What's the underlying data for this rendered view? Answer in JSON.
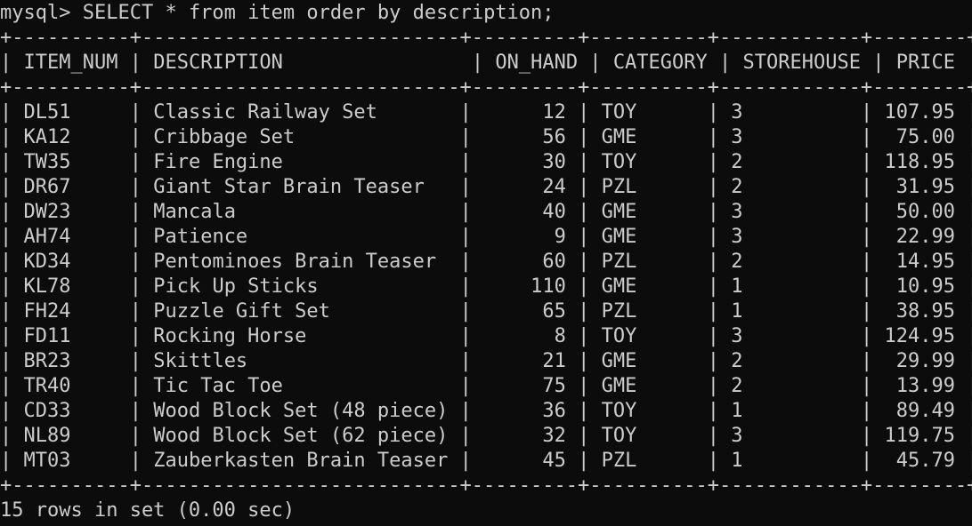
{
  "terminal": {
    "prompt": "mysql>",
    "command": "SELECT * from item order by description;",
    "border_line": "+----------+---------------------------+---------+----------+------------+--------+",
    "header": {
      "item_num": "ITEM_NUM",
      "description": "DESCRIPTION",
      "on_hand": "ON_HAND",
      "category": "CATEGORY",
      "storehouse": "STOREHOUSE",
      "price": "PRICE"
    },
    "rows": [
      {
        "item_num": "DL51",
        "description": "Classic Railway Set",
        "on_hand": "12",
        "category": "TOY",
        "storehouse": "3",
        "price": "107.95"
      },
      {
        "item_num": "KA12",
        "description": "Cribbage Set",
        "on_hand": "56",
        "category": "GME",
        "storehouse": "3",
        "price": "75.00"
      },
      {
        "item_num": "TW35",
        "description": "Fire Engine",
        "on_hand": "30",
        "category": "TOY",
        "storehouse": "2",
        "price": "118.95"
      },
      {
        "item_num": "DR67",
        "description": "Giant Star Brain Teaser",
        "on_hand": "24",
        "category": "PZL",
        "storehouse": "2",
        "price": "31.95"
      },
      {
        "item_num": "DW23",
        "description": "Mancala",
        "on_hand": "40",
        "category": "GME",
        "storehouse": "3",
        "price": "50.00"
      },
      {
        "item_num": "AH74",
        "description": "Patience",
        "on_hand": "9",
        "category": "GME",
        "storehouse": "3",
        "price": "22.99"
      },
      {
        "item_num": "KD34",
        "description": "Pentominoes Brain Teaser",
        "on_hand": "60",
        "category": "PZL",
        "storehouse": "2",
        "price": "14.95"
      },
      {
        "item_num": "KL78",
        "description": "Pick Up Sticks",
        "on_hand": "110",
        "category": "GME",
        "storehouse": "1",
        "price": "10.95"
      },
      {
        "item_num": "FH24",
        "description": "Puzzle Gift Set",
        "on_hand": "65",
        "category": "PZL",
        "storehouse": "1",
        "price": "38.95"
      },
      {
        "item_num": "FD11",
        "description": "Rocking Horse",
        "on_hand": "8",
        "category": "TOY",
        "storehouse": "3",
        "price": "124.95"
      },
      {
        "item_num": "BR23",
        "description": "Skittles",
        "on_hand": "21",
        "category": "GME",
        "storehouse": "2",
        "price": "29.99"
      },
      {
        "item_num": "TR40",
        "description": "Tic Tac Toe",
        "on_hand": "75",
        "category": "GME",
        "storehouse": "2",
        "price": "13.99"
      },
      {
        "item_num": "CD33",
        "description": "Wood Block Set (48 piece)",
        "on_hand": "36",
        "category": "TOY",
        "storehouse": "1",
        "price": "89.49"
      },
      {
        "item_num": "NL89",
        "description": "Wood Block Set (62 piece)",
        "on_hand": "32",
        "category": "TOY",
        "storehouse": "3",
        "price": "119.75"
      },
      {
        "item_num": "MT03",
        "description": "Zauberkasten Brain Teaser",
        "on_hand": "45",
        "category": "PZL",
        "storehouse": "1",
        "price": "45.79"
      }
    ],
    "result_summary": "15 rows in set (0.00 sec)"
  },
  "colors": {
    "background": "#0c0c0c",
    "foreground": "#cccccc"
  }
}
